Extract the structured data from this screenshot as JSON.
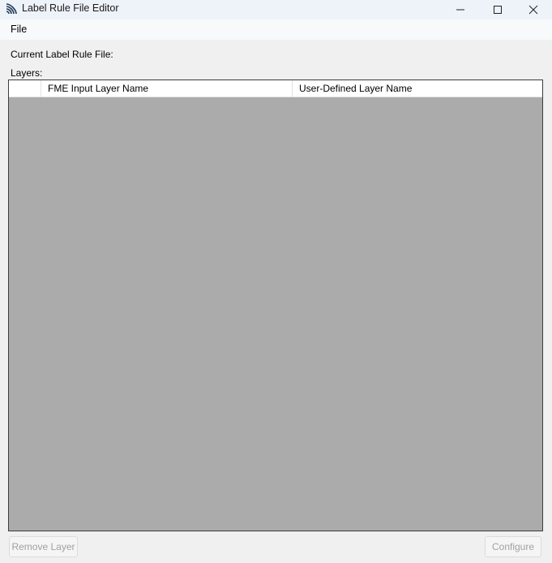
{
  "window": {
    "title": "Label Rule File Editor",
    "app_icon": "fme-logo-icon",
    "controls": {
      "minimize_icon": "minimize-icon",
      "maximize_icon": "maximize-icon",
      "close_icon": "close-icon"
    }
  },
  "menubar": {
    "items": [
      {
        "label": "File"
      }
    ]
  },
  "main": {
    "current_file_label": "Current Label Rule File:",
    "layers_label": "Layers:",
    "table": {
      "columns": [
        {
          "label": ""
        },
        {
          "label": "FME Input Layer Name"
        },
        {
          "label": "User-Defined Layer Name"
        }
      ],
      "rows": []
    }
  },
  "footer": {
    "remove_layer_label": "Remove Layer",
    "configure_label": "Configure",
    "remove_layer_enabled": false,
    "configure_enabled": false
  },
  "colors": {
    "titlebar": "#eef2f9",
    "menubar": "#f8f9fa",
    "window_bg": "#f0f0f0",
    "table_empty_bg": "#ababab",
    "disabled_text": "#a0a0a0"
  }
}
